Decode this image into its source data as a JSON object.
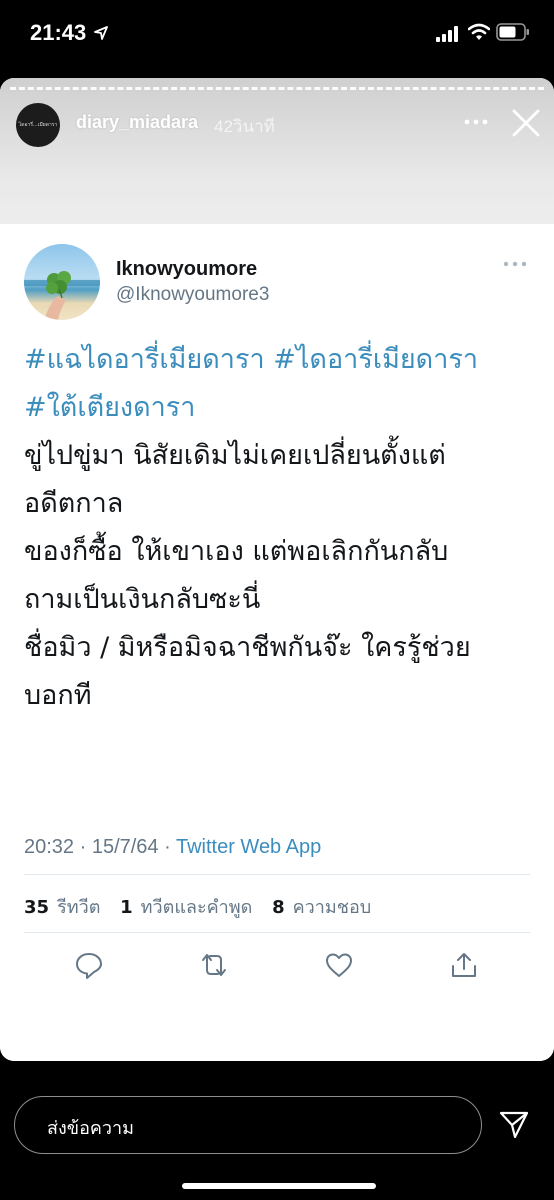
{
  "status_bar": {
    "time": "21:43"
  },
  "story": {
    "avatar_text": "ไดอารี่...เมียดารา",
    "username": "diary_miadara",
    "time_ago": "42วินาที"
  },
  "tweet": {
    "display_name": "Iknowyoumore",
    "handle": "@Iknowyoumore3",
    "hashtags": [
      "#แฉไดอารี่เมียดารา",
      "#ไดอารี่เมียดารา",
      "#ใต้เตียงดารา"
    ],
    "lines": [
      "ขู่ไปขู่มา นิสัยเดิมไม่เคยเปลี่ยนตั้งแต่",
      "อดีตกาล",
      "ของก็ซื้อ ให้เขาเอง แต่พอเลิกกันกลับ",
      "ถามเป็นเงินกลับซะนี่",
      "ชื่อมิว / มิหรือมิจฉาชีพกันจ๊ะ ใครรู้ช่วย",
      "บอกที"
    ],
    "timestamp": "20:32 · 15/7/64 · ",
    "source": "Twitter Web App",
    "stats": [
      {
        "count": "35",
        "label": "รีทวีต"
      },
      {
        "count": "1",
        "label": "ทวีตและคำพูด"
      },
      {
        "count": "8",
        "label": "ความชอบ"
      }
    ]
  },
  "reply_bar": {
    "placeholder": "ส่งข้อความ"
  },
  "icons": {
    "status": [
      "location-arrow-icon",
      "signal-icon",
      "wifi-icon",
      "battery-icon"
    ],
    "story": [
      "more-icon",
      "close-icon"
    ],
    "tweet_actions": [
      "reply-icon",
      "retweet-icon",
      "like-icon",
      "share-icon"
    ],
    "reply": [
      "send-icon"
    ]
  },
  "colors": {
    "link": "#3b8dbd",
    "muted": "#657786",
    "text": "#14171a"
  }
}
